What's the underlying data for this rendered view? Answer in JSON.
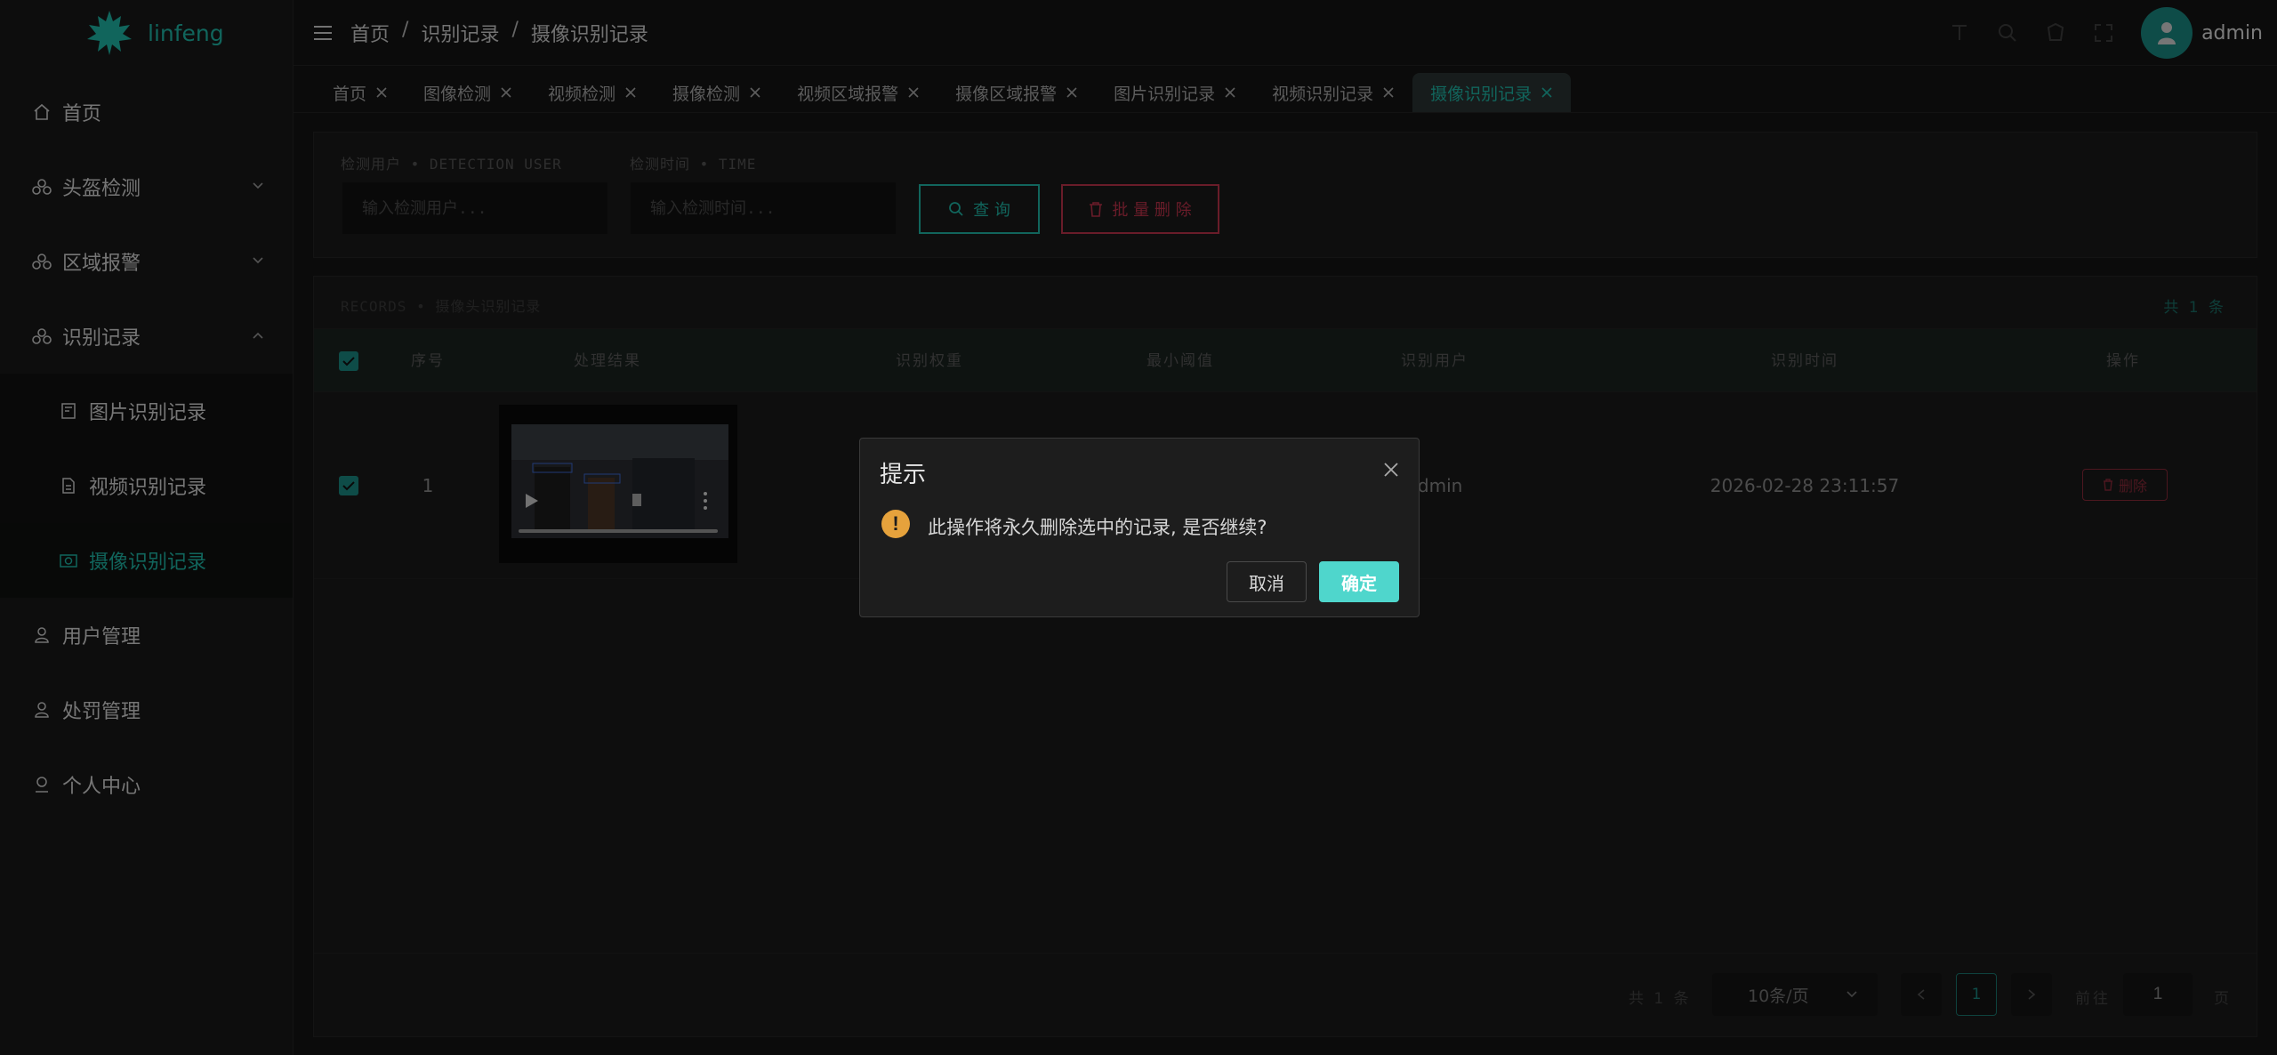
{
  "app": {
    "name": "linfeng"
  },
  "colors": {
    "accent": "#1fb8a8",
    "danger": "#c0344c",
    "warning": "#e6a23c",
    "confirm": "#4fd6cc"
  },
  "sidebar": {
    "items": [
      {
        "label": "首页",
        "icon": "home-icon"
      },
      {
        "label": "头盔检测",
        "icon": "helmet-icon",
        "expandable": true
      },
      {
        "label": "区域报警",
        "icon": "helmet-icon",
        "expandable": true
      },
      {
        "label": "识别记录",
        "icon": "helmet-icon",
        "expanded": true
      },
      {
        "label": "用户管理",
        "icon": "user-icon"
      },
      {
        "label": "处罚管理",
        "icon": "user-icon"
      },
      {
        "label": "个人中心",
        "icon": "profile-icon"
      }
    ],
    "subitems": [
      {
        "label": "图片识别记录",
        "icon": "image-record-icon"
      },
      {
        "label": "视频识别记录",
        "icon": "video-record-icon"
      },
      {
        "label": "摄像识别记录",
        "icon": "camera-record-icon",
        "active": true
      }
    ]
  },
  "header": {
    "breadcrumb": [
      "首页",
      "识别记录",
      "摄像识别记录"
    ],
    "user": "admin"
  },
  "tabs": [
    {
      "label": "首页"
    },
    {
      "label": "图像检测"
    },
    {
      "label": "视频检测"
    },
    {
      "label": "摄像检测"
    },
    {
      "label": "视频区域报警"
    },
    {
      "label": "摄像区域报警"
    },
    {
      "label": "图片识别记录"
    },
    {
      "label": "视频识别记录"
    },
    {
      "label": "摄像识别记录",
      "active": true
    }
  ],
  "search": {
    "user_label": "检测用户 • DETECTION USER",
    "time_label": "检测时间 • TIME",
    "user_placeholder": "输入检测用户...",
    "time_placeholder": "输入检测时间...",
    "query_label": "查 询",
    "batch_delete_label": "批 量 删 除"
  },
  "records": {
    "title": "RECORDS • 摄像头识别记录",
    "count": "共 1 条",
    "columns": [
      "序号",
      "处理结果",
      "识别权重",
      "最小阈值",
      "识别用户",
      "识别时间",
      "操作"
    ],
    "rows": [
      {
        "index": "1",
        "user": "admin",
        "time": "2026-02-28 23:11:57",
        "action": "删除"
      }
    ]
  },
  "pagination": {
    "total": "共 1 条",
    "page_size": "10条/页",
    "current": "1",
    "goto_label": "前往",
    "goto_value": "1",
    "page_suffix": "页"
  },
  "dialog": {
    "title": "提示",
    "message": "此操作将永久删除选中的记录, 是否继续?",
    "cancel": "取消",
    "confirm": "确定"
  }
}
